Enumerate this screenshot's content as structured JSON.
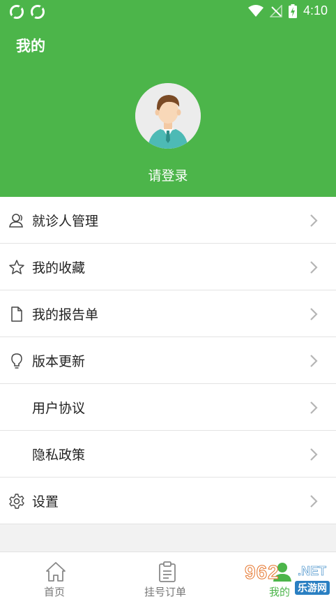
{
  "status_bar": {
    "time": "4:10",
    "icons": [
      "app-sync-icon",
      "app-sync-icon",
      "wifi-icon",
      "no-signal-icon",
      "battery-charging-icon"
    ]
  },
  "header": {
    "title": "我的",
    "login_prompt": "请登录",
    "accent_color": "#4cb54a"
  },
  "menu": {
    "items": [
      {
        "label": "就诊人管理",
        "icon": "person-icon"
      },
      {
        "label": "我的收藏",
        "icon": "star-icon"
      },
      {
        "label": "我的报告单",
        "icon": "document-icon"
      },
      {
        "label": "版本更新",
        "icon": "lightbulb-icon"
      },
      {
        "label": "用户协议",
        "icon": ""
      },
      {
        "label": "隐私政策",
        "icon": ""
      },
      {
        "label": "设置",
        "icon": "gear-icon"
      }
    ]
  },
  "tabbar": {
    "tabs": [
      {
        "label": "首页",
        "icon": "home-icon",
        "active": false
      },
      {
        "label": "挂号订单",
        "icon": "clipboard-icon",
        "active": false
      },
      {
        "label": "我的",
        "icon": "user-icon",
        "active": true
      }
    ]
  },
  "watermark": {
    "main": "962",
    "suffix": ".NET",
    "cn": "乐游网"
  }
}
